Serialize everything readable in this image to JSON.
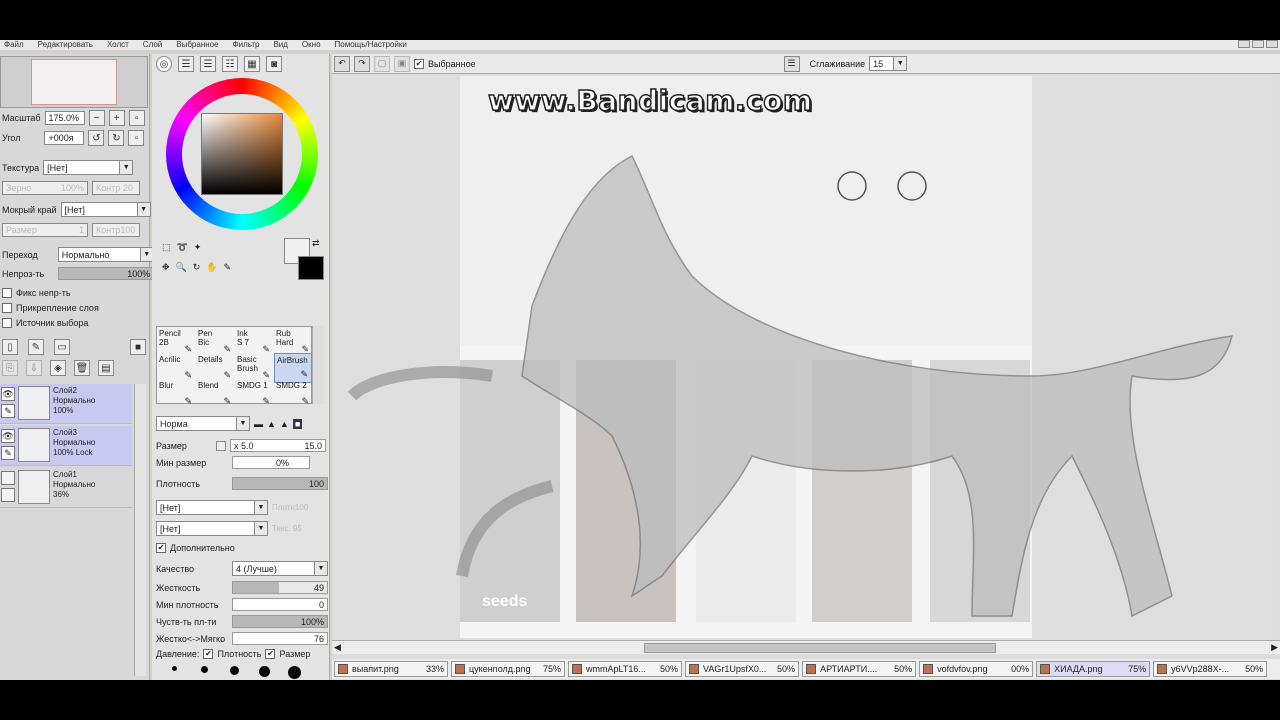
{
  "menu": [
    "Файл",
    "Редактировать",
    "Холст",
    "Слой",
    "Выбранное",
    "Фильтр",
    "Вид",
    "Окно",
    "Помощь/Настройки"
  ],
  "watermark": "www.Bandicam.com",
  "nav": {
    "zoom_label": "Масштаб",
    "zoom_value": "175.0%",
    "angle_label": "Угол",
    "angle_value": "+000я"
  },
  "texture": {
    "label": "Текстура",
    "value": "[Нет]",
    "grain": "Зерно",
    "grain_val": "100%",
    "contr": "Контр 20"
  },
  "wet_edge": {
    "label": "Мокрый край",
    "value": "[Нет]",
    "size": "Размер",
    "size_val": "1",
    "contr": "Контр100"
  },
  "blend": {
    "label": "Переход",
    "value": "Нормально"
  },
  "opacity": {
    "label": "Непроз-ть",
    "value": "100%",
    "fraction": 1.0
  },
  "checks": [
    {
      "label": "Фикс непр-ть",
      "checked": false
    },
    {
      "label": "Прикрепление слоя",
      "checked": false
    },
    {
      "label": "Источник выбора",
      "checked": false
    }
  ],
  "layers": [
    {
      "name": "Слой2",
      "mode": "Нормально",
      "opacity": "100%",
      "extra": "",
      "selected": true
    },
    {
      "name": "Слой3",
      "mode": "Нормально",
      "opacity": "100%",
      "extra": "Lock",
      "selected": true
    },
    {
      "name": "Слой1",
      "mode": "Нормально",
      "opacity": "36%",
      "extra": "",
      "selected": false
    }
  ],
  "brushes": [
    {
      "name": "Pencil",
      "size": "2B"
    },
    {
      "name": "Pen",
      "size": "Bic"
    },
    {
      "name": "Ink",
      "size": "S 7"
    },
    {
      "name": "Rub",
      "size": "Hard"
    },
    {
      "name": "Acrilic",
      "size": ""
    },
    {
      "name": "Details",
      "size": ""
    },
    {
      "name": "Basic",
      "size": "Brush"
    },
    {
      "name": "AirBrush",
      "size": ""
    },
    {
      "name": "Blur",
      "size": ""
    },
    {
      "name": "Blend",
      "size": ""
    },
    {
      "name": "SMDG 1",
      "size": ""
    },
    {
      "name": "SMDG 2",
      "size": ""
    }
  ],
  "brush_settings": {
    "mode": "Норма",
    "size_label": "Размер",
    "size_mult": "x 5.0",
    "size_val": "15.0",
    "minsize_label": "Мин размер",
    "minsize_val": "0%",
    "density_label": "Плотность",
    "density_val": "100",
    "shape1": "[Нет]",
    "shape1_r": "Плотн100",
    "shape2": "[Нет]",
    "shape2_r": "Текс. 95",
    "advanced_label": "Дополнительно",
    "quality_label": "Качество",
    "quality_val": "4 (Лучше)",
    "hardness_label": "Жесткость",
    "hardness_val": "49",
    "mindensity_label": "Мин плотность",
    "mindensity_val": "0",
    "sens_label": "Чуств-ть пл-ти",
    "sens_val": "100%",
    "softhard_label": "Жестко<->Мягко",
    "softhard_val": "76",
    "pressure_label": "Давление:",
    "pressure_density": "Плотность",
    "pressure_size": "Размер"
  },
  "dot_sizes": [
    "10",
    "12",
    "14",
    "16",
    "20"
  ],
  "toolbar": {
    "selection_label": "Выбранное",
    "smooth_label": "Сглаживание",
    "smooth_val": "15"
  },
  "tabs": [
    {
      "name": "выапит.png",
      "zoom": "33%"
    },
    {
      "name": "цукенnолд.png",
      "zoom": "75%"
    },
    {
      "name": "wmmApLT16...",
      "zoom": "50%"
    },
    {
      "name": "VAGr1UpsfX0...",
      "zoom": "50%"
    },
    {
      "name": "АРТИАРТИ....",
      "zoom": "50%"
    },
    {
      "name": "vofdvfov.png",
      "zoom": "00%"
    },
    {
      "name": "ХИАДА.png",
      "zoom": "75%"
    },
    {
      "name": "y6VVp288X-...",
      "zoom": "50%"
    }
  ],
  "colors": {
    "accent_select": "#c8c8f0",
    "tab_active": "#dcdcf6",
    "fg_color": "#000000",
    "bg_color": "#f0f0f0"
  }
}
